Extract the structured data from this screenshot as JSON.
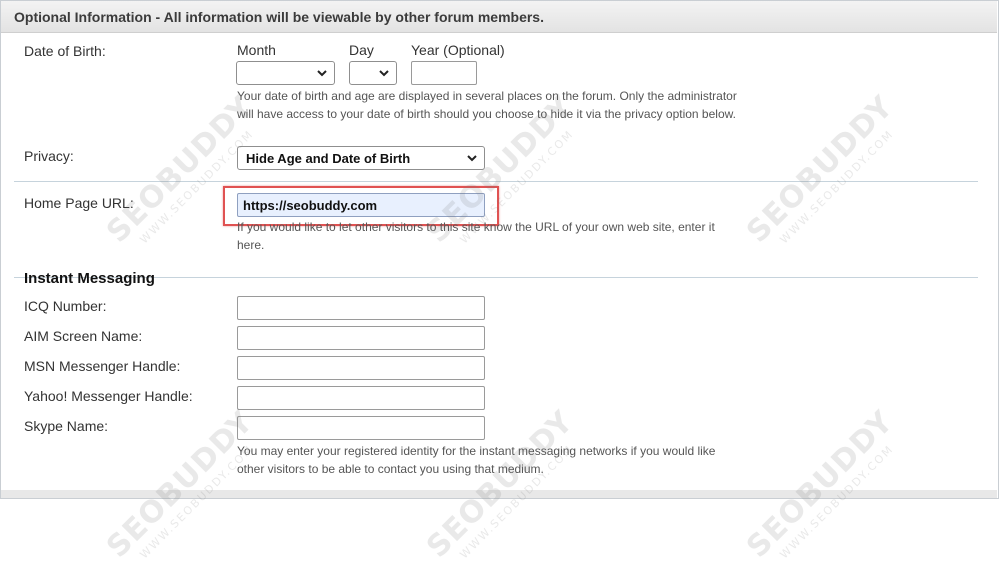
{
  "header": {
    "title": "Optional Information - All information will be viewable by other forum members."
  },
  "dob": {
    "label": "Date of Birth:",
    "month_label": "Month",
    "day_label": "Day",
    "year_label": "Year (Optional)",
    "month_value": "",
    "day_value": "",
    "year_value": "",
    "help": "Your date of birth and age are displayed in several places on the forum. Only the administrator will have access to your date of birth should you choose to hide it via the privacy option below."
  },
  "privacy": {
    "label": "Privacy:",
    "value": "Hide Age and Date of Birth"
  },
  "homepage": {
    "label": "Home Page URL:",
    "value": "https://seobuddy.com",
    "help": "If you would like to let other visitors to this site know the URL of your own web site, enter it here."
  },
  "im": {
    "heading": "Instant Messaging",
    "fields": [
      {
        "label": "ICQ Number:",
        "value": ""
      },
      {
        "label": "AIM Screen Name:",
        "value": ""
      },
      {
        "label": "MSN Messenger Handle:",
        "value": ""
      },
      {
        "label": "Yahoo! Messenger Handle:",
        "value": ""
      },
      {
        "label": "Skype Name:",
        "value": ""
      }
    ],
    "help": "You may enter your registered identity for the instant messaging networks if you would like other visitors to be able to contact you using that medium."
  },
  "watermark": {
    "brand": "SEOBUDDY",
    "domain": "WWW.SEOBUDDY.COM"
  },
  "colors": {
    "highlight": "#e05252",
    "url_field_bg": "#e8f0fe",
    "header_bg": "#e8e8e8"
  }
}
